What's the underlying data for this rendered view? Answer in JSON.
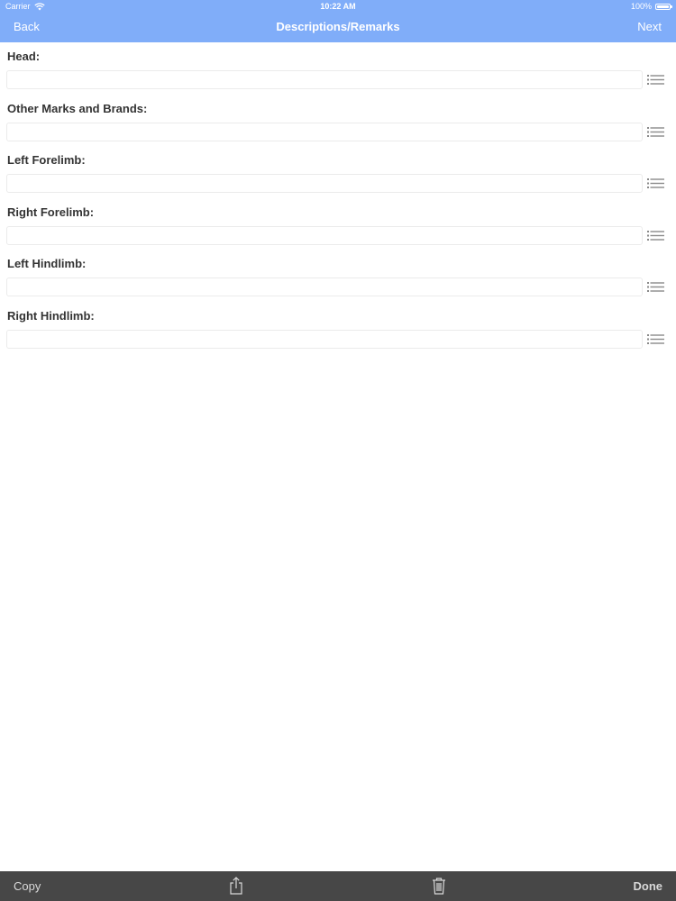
{
  "status_bar": {
    "carrier": "Carrier",
    "time": "10:22 AM",
    "battery": "100%"
  },
  "nav": {
    "back_label": "Back",
    "title": "Descriptions/Remarks",
    "next_label": "Next"
  },
  "fields": [
    {
      "label": "Head:",
      "value": ""
    },
    {
      "label": "Other Marks and Brands:",
      "value": ""
    },
    {
      "label": "Left Forelimb:",
      "value": ""
    },
    {
      "label": "Right Forelimb:",
      "value": ""
    },
    {
      "label": "Left Hindlimb:",
      "value": ""
    },
    {
      "label": "Right Hindlimb:",
      "value": ""
    }
  ],
  "toolbar": {
    "copy_label": "Copy",
    "done_label": "Done"
  },
  "colors": {
    "nav_background": "#80adf9",
    "toolbar_background": "#474747",
    "list_icon": "#8a8a8a"
  },
  "icons": {
    "list": "list-icon",
    "share": "share-icon",
    "trash": "trash-icon",
    "wifi": "wifi-icon",
    "battery": "battery-icon"
  }
}
